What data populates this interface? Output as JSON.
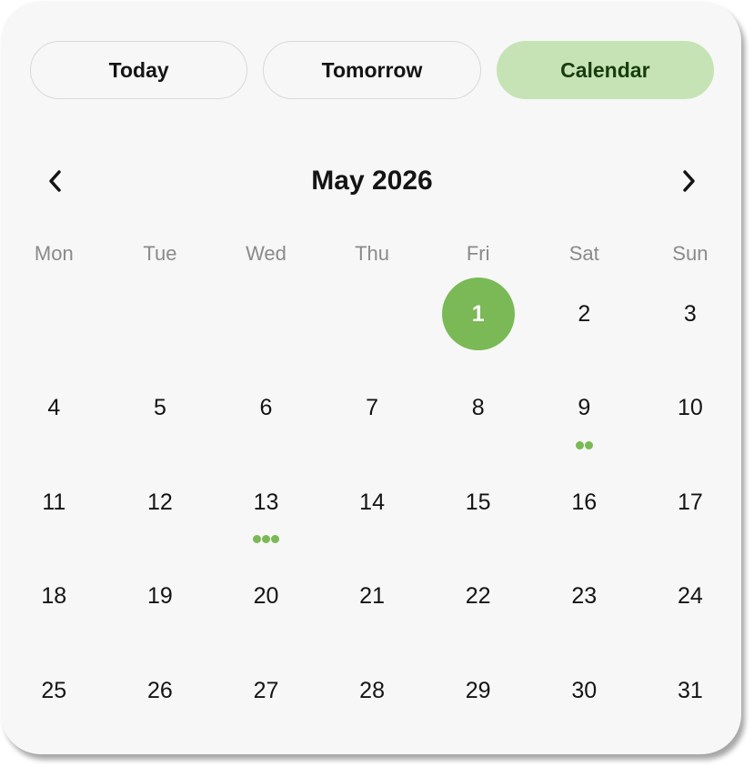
{
  "tabs": [
    {
      "label": "Today",
      "active": false
    },
    {
      "label": "Tomorrow",
      "active": false
    },
    {
      "label": "Calendar",
      "active": true
    }
  ],
  "calendar": {
    "month_title": "May 2026",
    "prev_icon": "chevron-left-icon",
    "next_icon": "chevron-right-icon",
    "weekdays": [
      "Mon",
      "Tue",
      "Wed",
      "Thu",
      "Fri",
      "Sat",
      "Sun"
    ],
    "first_weekday_index": 4,
    "days_in_month": 31,
    "selected_day": 1,
    "event_dots": {
      "9": 2,
      "13": 3
    }
  },
  "colors": {
    "accent": "#7ab955",
    "accent_light": "#c6e3b6",
    "card_bg": "#f7f7f7",
    "text": "#141414",
    "weekday_text": "#8a8a8a"
  }
}
